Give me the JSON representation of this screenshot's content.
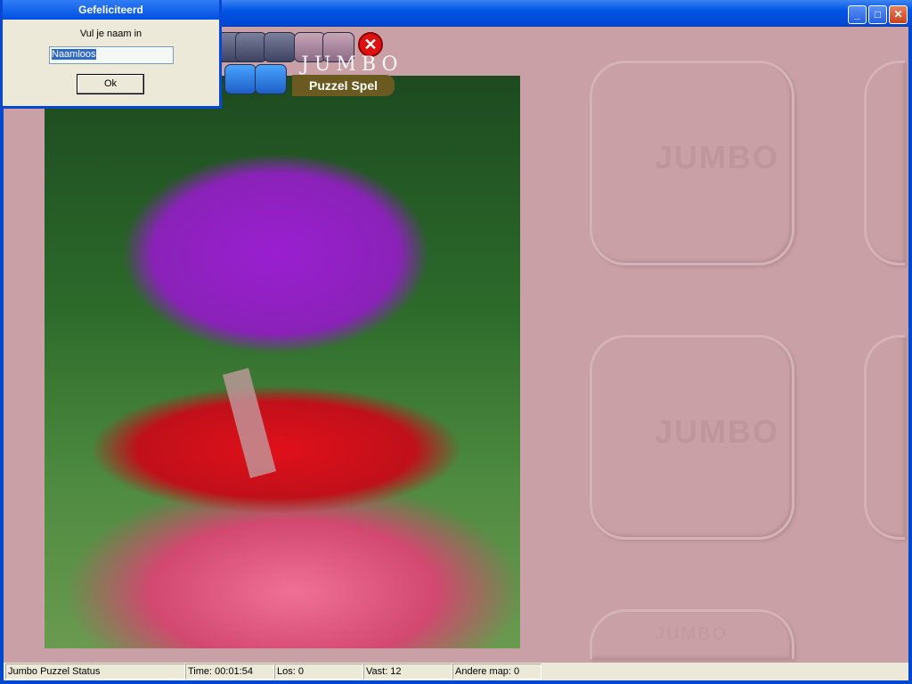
{
  "window": {
    "minimize": "_",
    "maximize": "□",
    "close": "✕"
  },
  "toolbar": {
    "jumbo_text": "JUMBO",
    "banner": "Puzzel Spel",
    "exit_label": "✕"
  },
  "watermark": "JUMBO",
  "dialog": {
    "title": "Gefeliciteerd",
    "prompt": "Vul je naam in",
    "name_value": "Naamloos",
    "ok_label": "Ok"
  },
  "status": {
    "app": "Jumbo Puzzel Status",
    "time": "Time: 00:01:54",
    "los": "Los: 0",
    "vast": "Vast: 12",
    "andere": "Andere map: 0"
  }
}
